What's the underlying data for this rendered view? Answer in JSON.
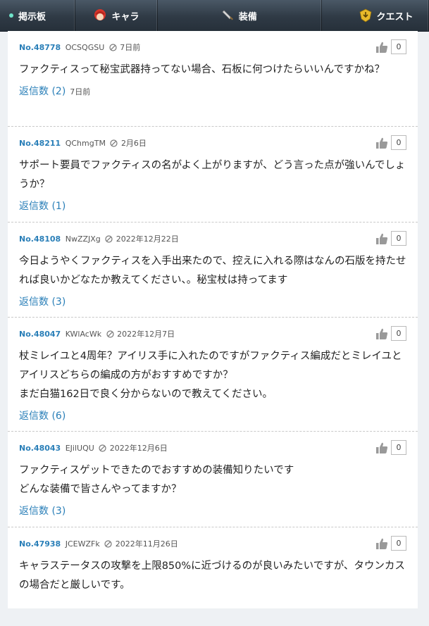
{
  "nav": {
    "items": [
      {
        "label": "掲示板",
        "icon": "board-dot-icon"
      },
      {
        "label": "キャラ",
        "icon": "character-icon"
      },
      {
        "label": "装備",
        "icon": "sword-icon"
      },
      {
        "label": "クエスト",
        "icon": "quest-icon"
      }
    ]
  },
  "posts": [
    {
      "no": "No.48778",
      "user": "OCSQGSU",
      "date": "7日前",
      "likes": "0",
      "body": "ファクティスって秘宝武器持ってない場合、石板に何つけたらいいんですかね？",
      "replies": "返信数 (2)",
      "reply_age": "7日前"
    },
    {
      "no": "No.48211",
      "user": "QChmgTM",
      "date": "2月6日",
      "likes": "0",
      "body": "サポート要員でファクティスの名がよく上がりますが、どう言った点が強いんでしょうか？",
      "replies": "返信数 (1)",
      "reply_age": ""
    },
    {
      "no": "No.48108",
      "user": "NwZZJXg",
      "date": "2022年12月22日",
      "likes": "0",
      "body": "今日ようやくファクティスを入手出来たので、控えに入れる際はなんの石版を持たせれば良いかどなたか教えてください、。秘宝杖は持ってます",
      "replies": "返信数 (3)",
      "reply_age": ""
    },
    {
      "no": "No.48047",
      "user": "KWlAcWk",
      "date": "2022年12月7日",
      "likes": "0",
      "body": "杖ミレイユと4周年？アイリス手に入れたのですがファクティス編成だとミレイユとアイリスどちらの編成の方がおすすめですか？\nまだ白猫162日で良く分からないので教えてください。",
      "replies": "返信数 (6)",
      "reply_age": ""
    },
    {
      "no": "No.48043",
      "user": "EJilUQU",
      "date": "2022年12月6日",
      "likes": "0",
      "body": "ファクティスゲットできたのでおすすめの装備知りたいです\nどんな装備で皆さんやってますか？",
      "replies": "返信数 (3)",
      "reply_age": ""
    },
    {
      "no": "No.47938",
      "user": "JCEWZFk",
      "date": "2022年11月26日",
      "likes": "0",
      "body": "キャラステータスの攻撃を上限850%に近づけるのが良いみたいですが、タウンカスの場合だと厳しいです。",
      "replies": "",
      "reply_age": ""
    }
  ],
  "colors": {
    "link": "#2a7fb8",
    "nav_bg": "#2f3a45",
    "page_bg": "#eef1f4"
  }
}
